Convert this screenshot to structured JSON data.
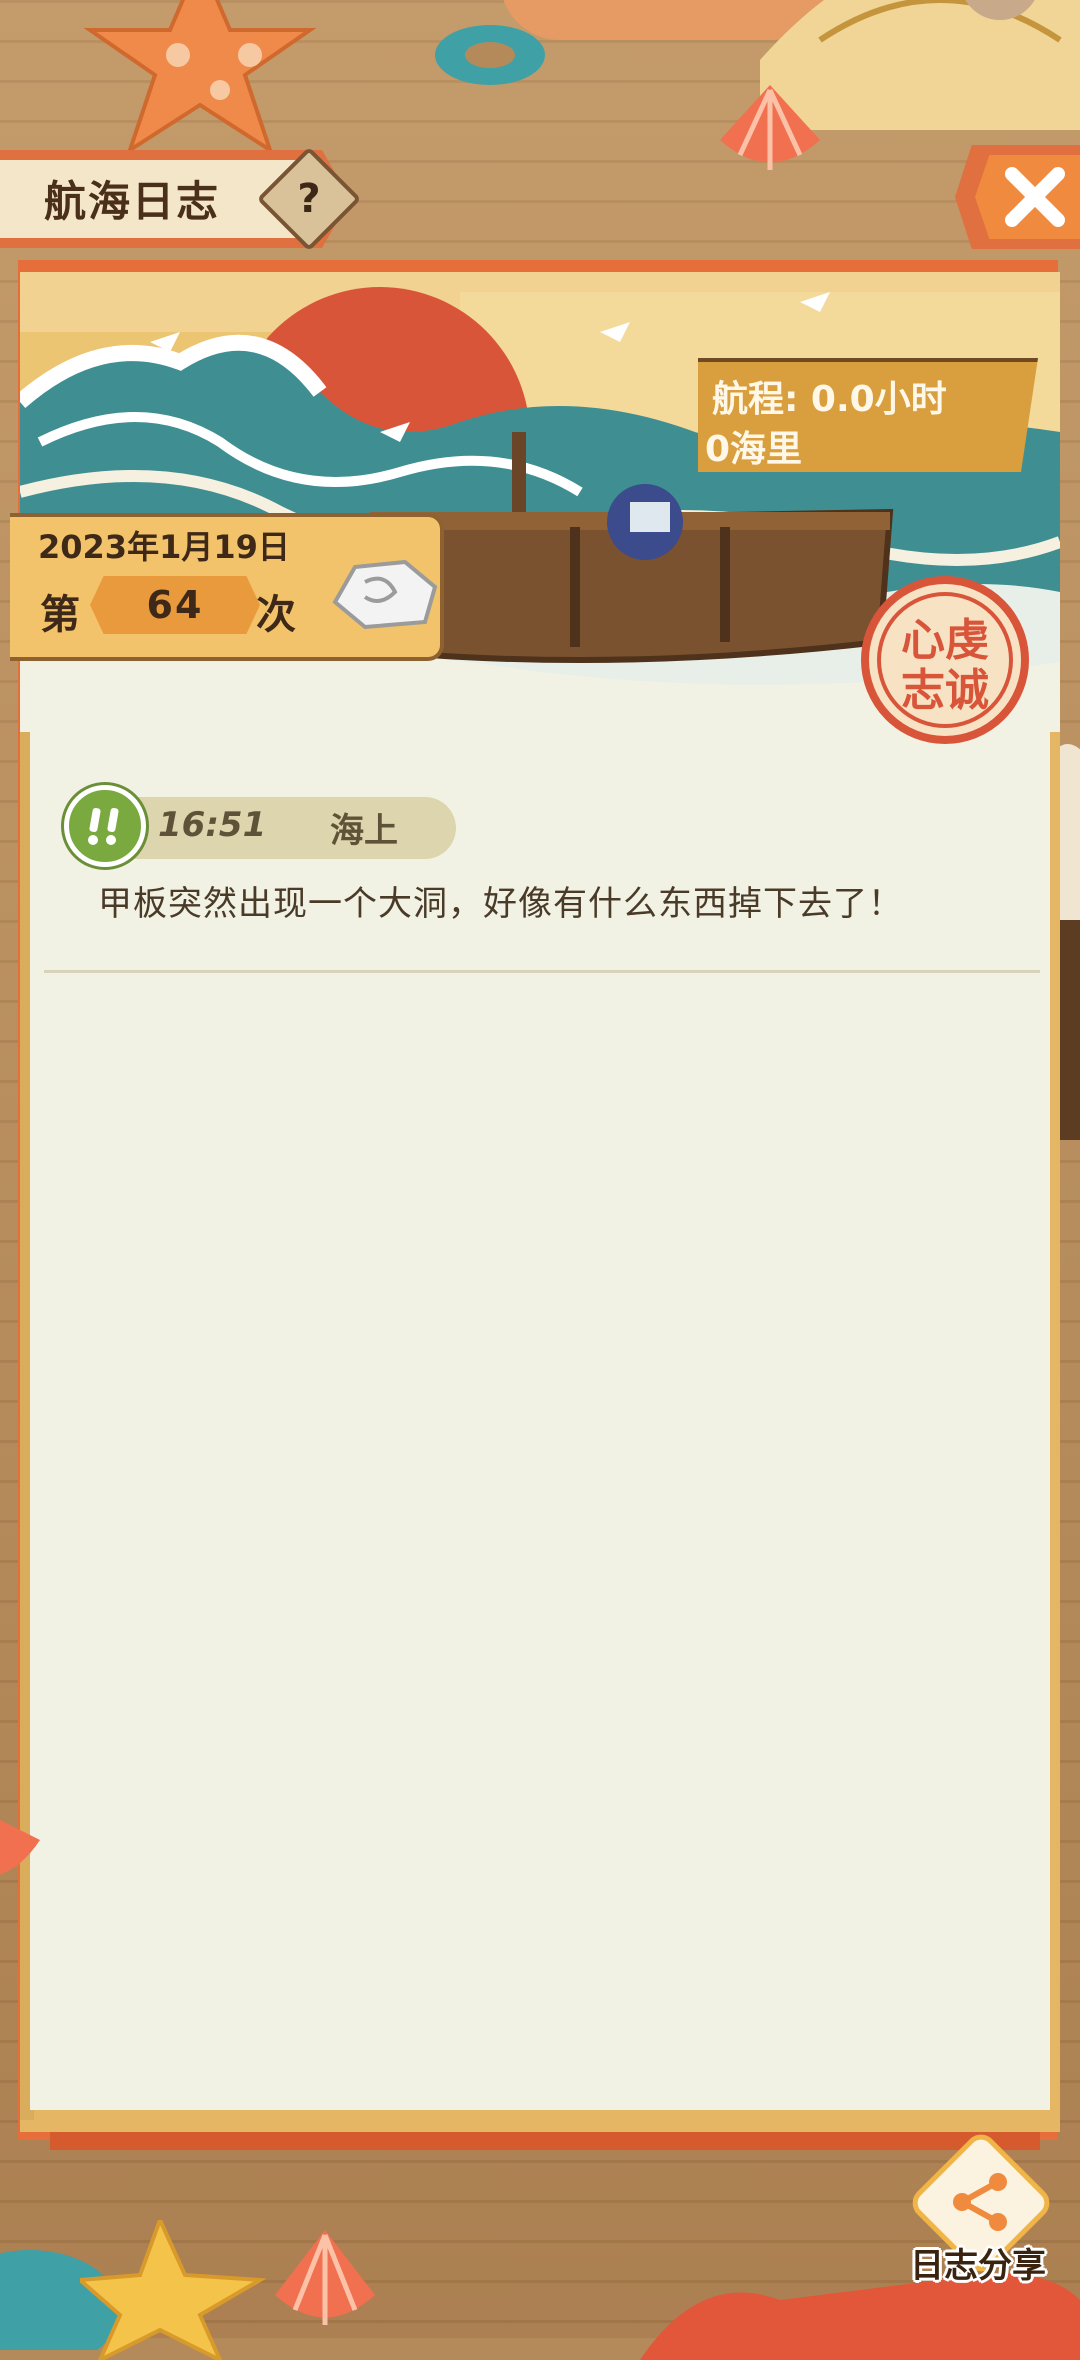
{
  "header": {
    "title": "航海日志",
    "help_label": "?"
  },
  "voyage": {
    "duration": "航程: 0.0小时",
    "distance": "0海里"
  },
  "date_badge": {
    "date": "2023年1月19日",
    "prefix": "第",
    "count": "64",
    "suffix": "次"
  },
  "stamp": {
    "text_line1": "心虔",
    "text_line2": "志诚"
  },
  "log_entries": [
    {
      "time": "16:51",
      "place": "海上",
      "text": "甲板突然出现一个大洞，好像有什么东西掉下去了！"
    }
  ],
  "footer": {
    "share_label": "日志分享"
  },
  "colors": {
    "accent_orange": "#e0703f",
    "paper": "#f1f2e4",
    "banner_gold": "#e5b765",
    "wave_teal": "#3f8f92"
  }
}
